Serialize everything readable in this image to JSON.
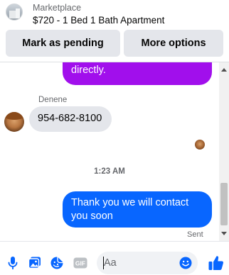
{
  "header": {
    "category": "Marketplace",
    "listing_title": "$720 - 1 Bed 1 Bath Apartment",
    "pending_button": "Mark as pending",
    "more_button": "More options"
  },
  "messages": {
    "partial_outgoing": "directly.",
    "sender_name": "Denene",
    "incoming_text": "954-682-8100",
    "timestamp": "1:23 AM",
    "outgoing_text": "Thank you we will contact you soon",
    "status": "Sent"
  },
  "composer": {
    "placeholder": "Aa",
    "icons": [
      "microphone-icon",
      "photo-icon",
      "sticker-icon",
      "gif-icon",
      "emoji-icon",
      "thumbs-up-icon"
    ]
  },
  "colors": {
    "accent_blue": "#0866ff",
    "outgoing_purple": "#a10fec",
    "incoming_grey": "#e4e6eb",
    "button_grey": "#e4e6eb",
    "muted_text": "#65676b"
  }
}
